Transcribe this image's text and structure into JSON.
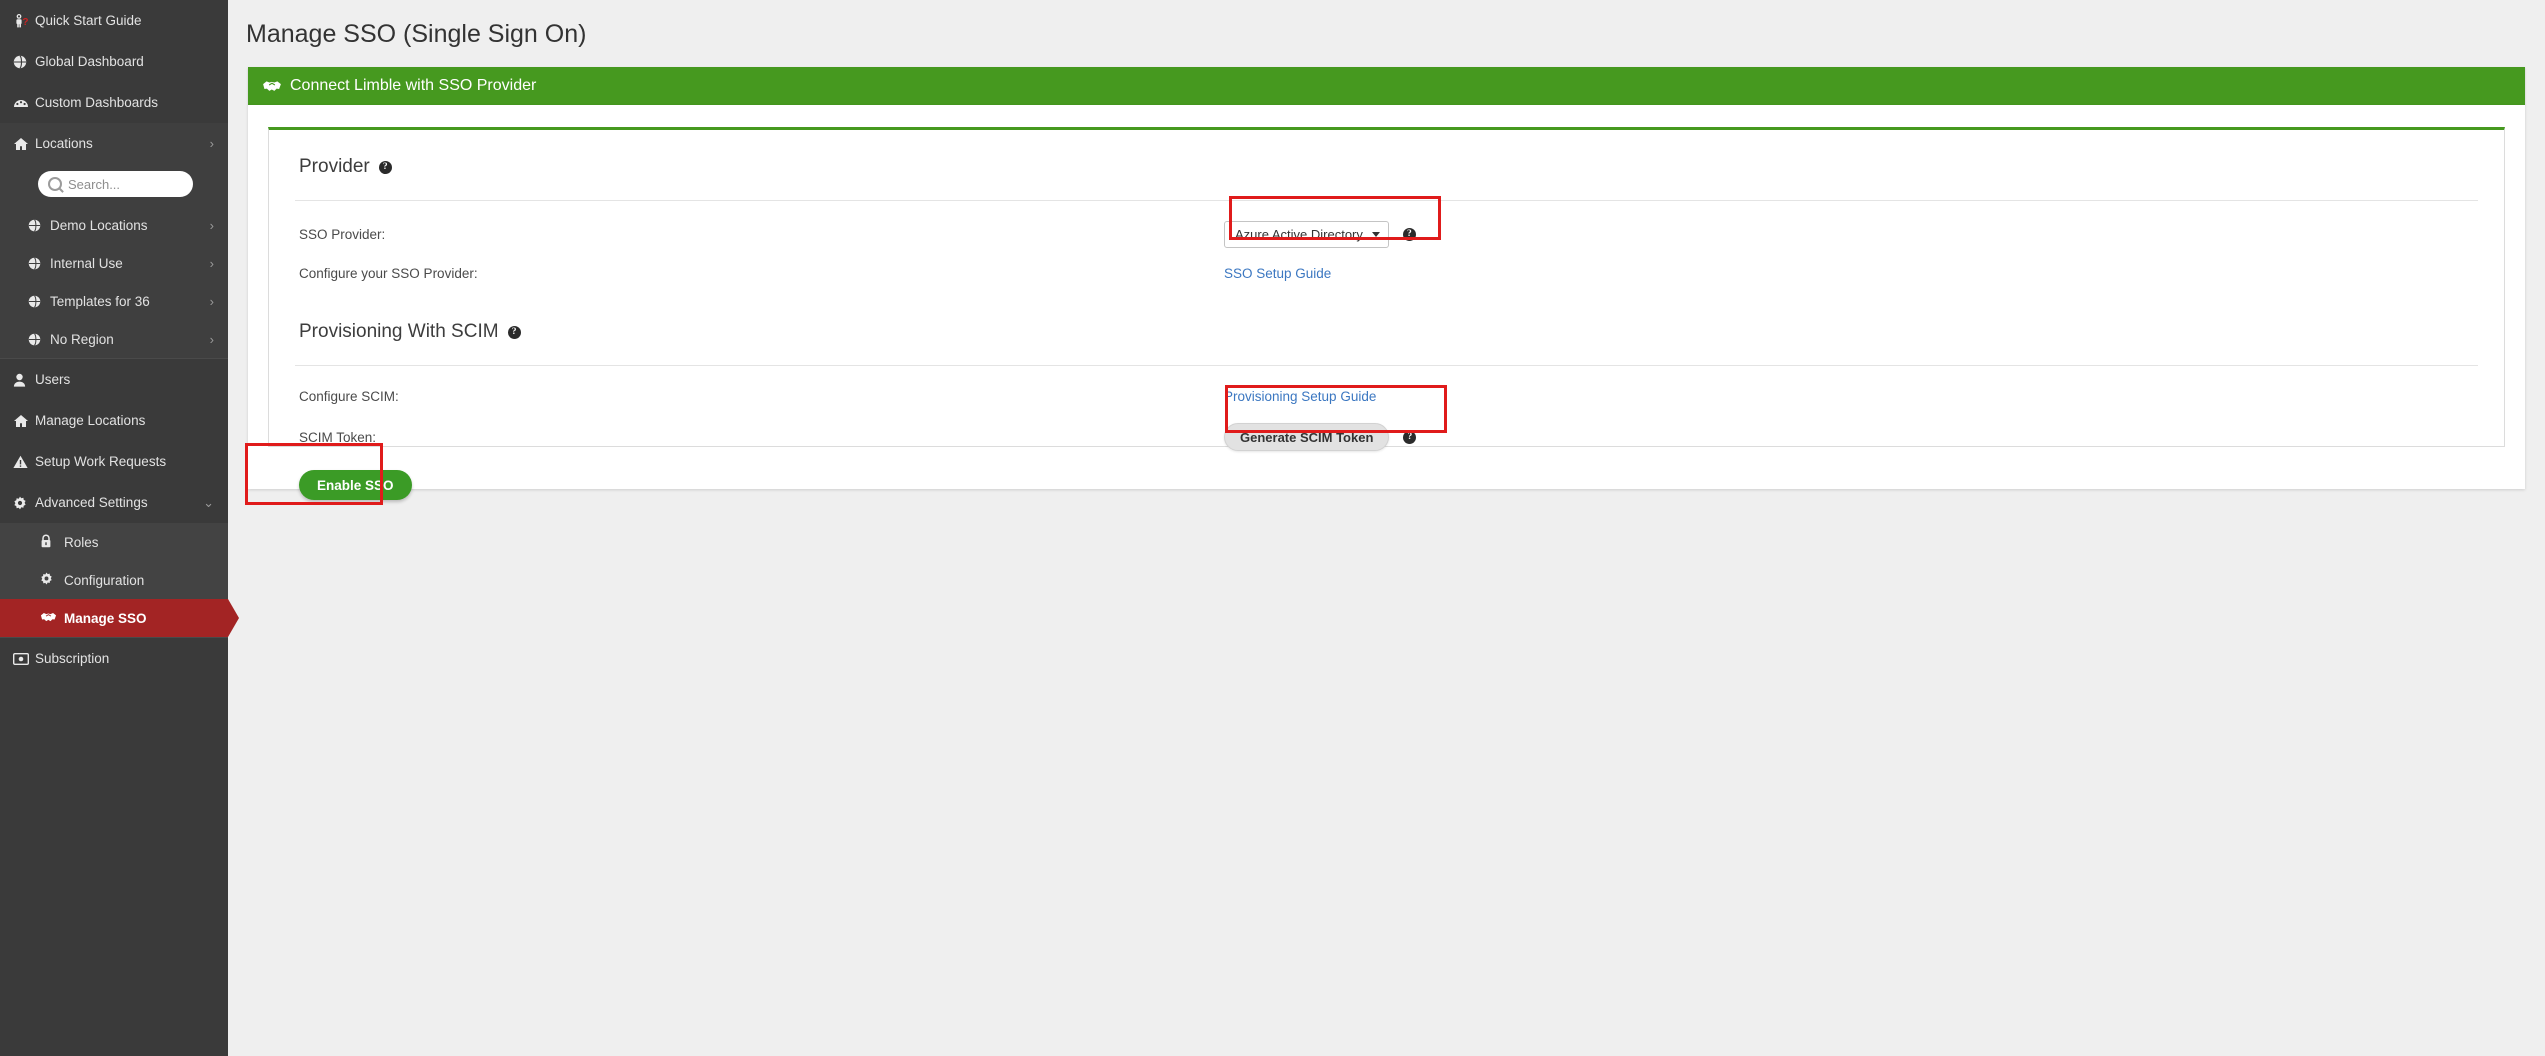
{
  "sidebar": {
    "items": [
      {
        "label": "Quick Start Guide",
        "icon": "astronaut-question-icon",
        "chevron": ""
      },
      {
        "label": "Global Dashboard",
        "icon": "globe-icon",
        "chevron": ""
      },
      {
        "label": "Custom Dashboards",
        "icon": "gauge-icon",
        "chevron": ""
      },
      {
        "label": "Locations",
        "icon": "home-icon",
        "chevron": "›"
      }
    ],
    "search": {
      "placeholder": "Search...",
      "value": "",
      "icon": "search-icon"
    },
    "locations": [
      {
        "label": "Demo Locations",
        "icon": "globe-icon",
        "chevron": "›"
      },
      {
        "label": "Internal Use",
        "icon": "globe-icon",
        "chevron": "›"
      },
      {
        "label": "Templates for 36",
        "icon": "globe-icon",
        "chevron": "›"
      },
      {
        "label": "No Region",
        "icon": "globe-icon",
        "chevron": "›"
      }
    ],
    "lower": [
      {
        "label": "Users",
        "icon": "person-icon",
        "chevron": ""
      },
      {
        "label": "Manage Locations",
        "icon": "home-icon",
        "chevron": ""
      },
      {
        "label": "Setup Work Requests",
        "icon": "warning-icon",
        "chevron": ""
      },
      {
        "label": "Advanced Settings",
        "icon": "gear-icon",
        "chevron": "⌄"
      }
    ],
    "advanced_children": [
      {
        "label": "Roles",
        "icon": "lock-icon",
        "active": false
      },
      {
        "label": "Configuration",
        "icon": "gear-icon",
        "active": false
      },
      {
        "label": "Manage SSO",
        "icon": "handshake-icon",
        "active": true
      }
    ],
    "bottom": [
      {
        "label": "Subscription",
        "icon": "card-icon",
        "chevron": ""
      }
    ],
    "active_color": "#a32424"
  },
  "header": {
    "title": "Manage SSO (Single Sign On)"
  },
  "banner": {
    "title": "Connect Limble with SSO Provider",
    "icon": "handshake-icon",
    "color": "#46991f"
  },
  "provider_section": {
    "heading": "Provider",
    "help_icon": "question-circle-icon",
    "sso_provider_label": "SSO Provider:",
    "sso_provider_value": "Azure Active Directory",
    "sso_provider_help_icon": "question-circle-icon",
    "configure_label": "Configure your SSO Provider:",
    "setup_guide_link": "SSO Setup Guide"
  },
  "scim_section": {
    "heading": "Provisioning With SCIM",
    "help_icon": "question-circle-icon",
    "configure_label": "Configure SCIM:",
    "provisioning_guide_link": "Provisioning Setup Guide",
    "token_label": "SCIM Token:",
    "generate_button": "Generate SCIM Token",
    "generate_help_icon": "question-circle-icon"
  },
  "footer": {
    "enable_button": "Enable SSO"
  },
  "annotations": {
    "color": "#e01b1b"
  }
}
